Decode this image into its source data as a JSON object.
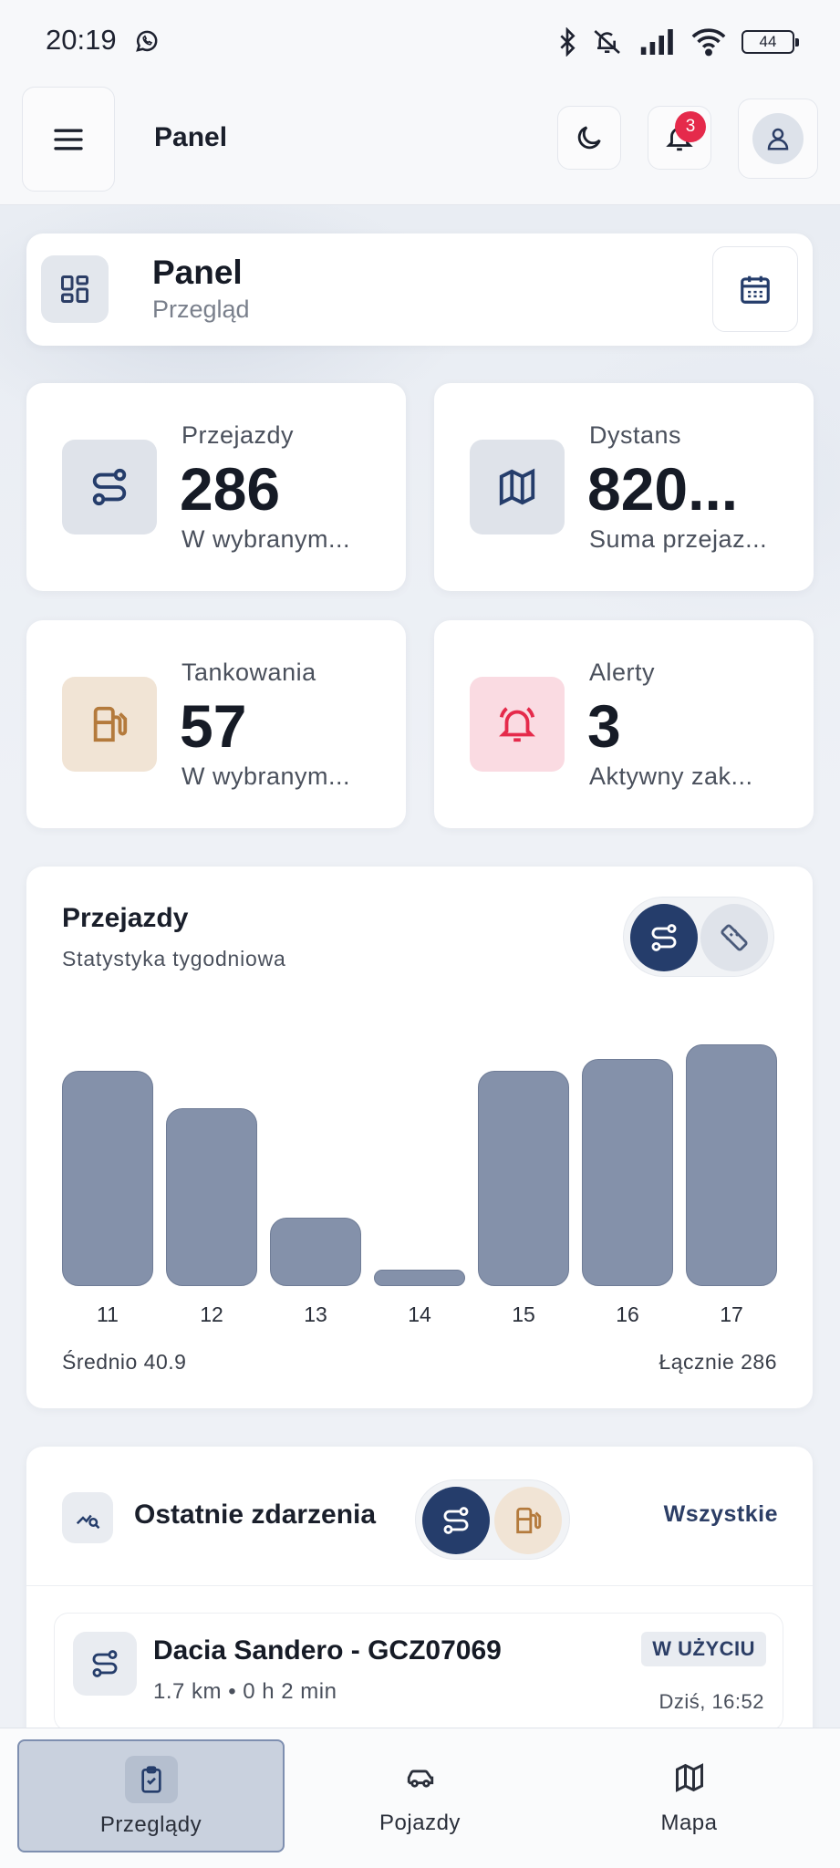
{
  "status_bar": {
    "time": "20:19",
    "battery": "44"
  },
  "app_bar": {
    "title": "Panel",
    "notification_count": "3"
  },
  "header": {
    "title": "Panel",
    "subtitle": "Przegląd"
  },
  "stats": [
    {
      "label": "Przejazdy",
      "value": "286",
      "sub": "W wybranym..."
    },
    {
      "label": "Dystans",
      "value": "820...",
      "sub": "Suma przejaz..."
    },
    {
      "label": "Tankowania",
      "value": "57",
      "sub": "W wybranym..."
    },
    {
      "label": "Alerty",
      "value": "3",
      "sub": "Aktywny zak..."
    }
  ],
  "chart": {
    "title": "Przejazdy",
    "subtitle": "Statystyka tygodniowa",
    "average_label": "Średnio 40.9",
    "total_label": "Łącznie 286"
  },
  "chart_data": {
    "type": "bar",
    "categories": [
      "11",
      "12",
      "13",
      "14",
      "15",
      "16",
      "17"
    ],
    "values": [
      57,
      47,
      18,
      4,
      57,
      60,
      64
    ],
    "ylim": [
      0,
      70
    ],
    "grid": false,
    "color": "#8491aa"
  },
  "events": {
    "title": "Ostatnie zdarzenia",
    "all_link": "Wszystkie",
    "items": [
      {
        "name": "Dacia Sandero - GCZ07069",
        "meta": "1.7 km • 0 h 2 min",
        "status": "W UŻYCIU",
        "time": "Dziś, 16:52"
      }
    ]
  },
  "nav": [
    {
      "label": "Przeglądy",
      "icon": "clipboard-check-icon",
      "active": true
    },
    {
      "label": "Pojazdy",
      "icon": "car-icon",
      "active": false
    },
    {
      "label": "Mapa",
      "icon": "map-icon",
      "active": false
    }
  ],
  "colors": {
    "accent": "#253d6b",
    "alert": "#e52a4b",
    "fuel": "#b47a3c"
  }
}
